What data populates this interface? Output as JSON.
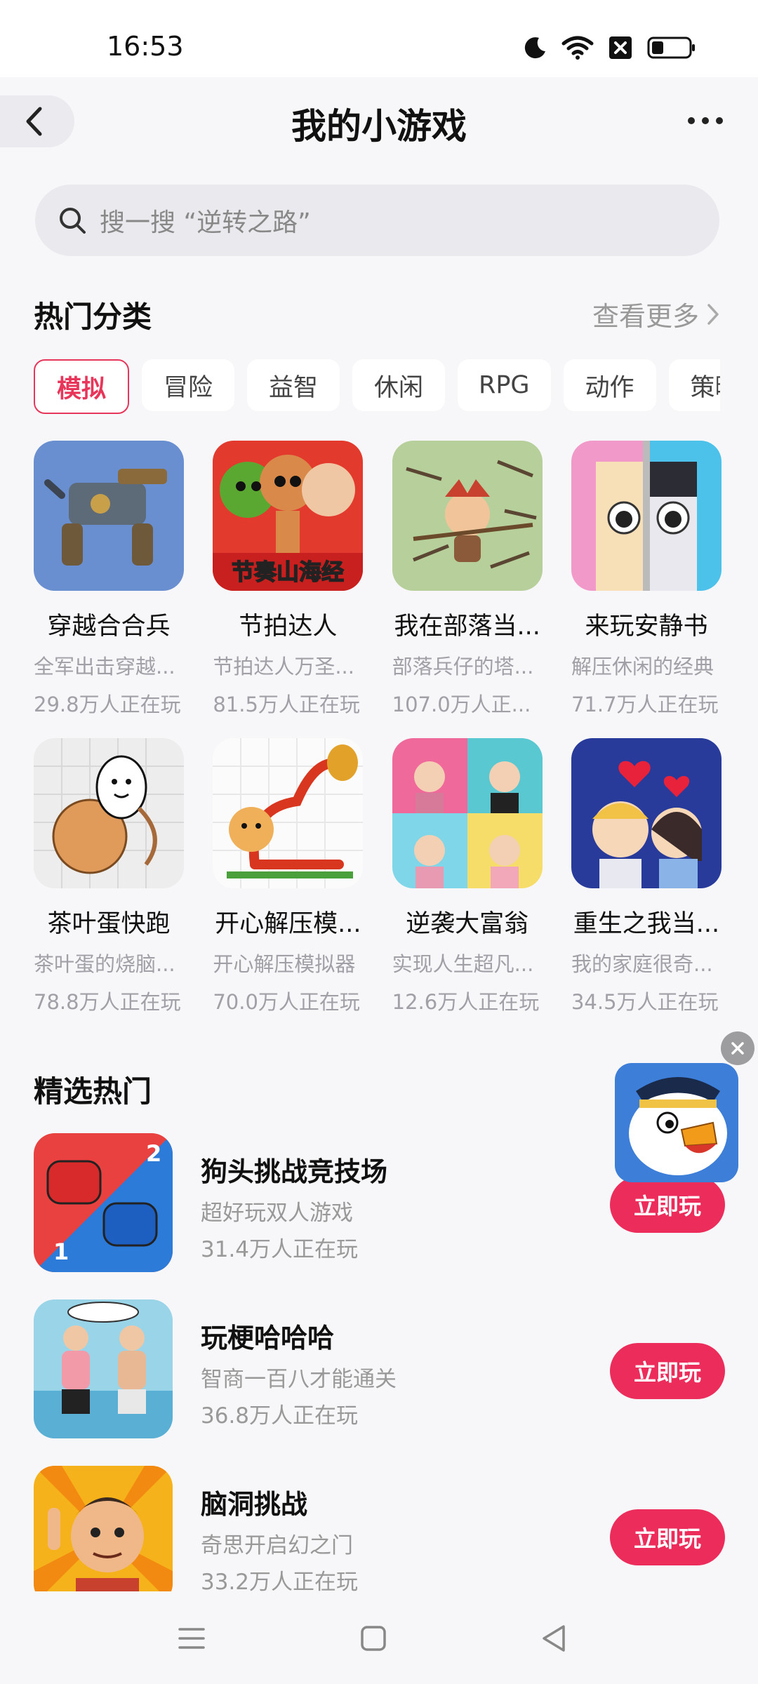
{
  "status": {
    "time": "16:53"
  },
  "header": {
    "title": "我的小游戏"
  },
  "search": {
    "placeholder": "搜一搜 “逆转之路”"
  },
  "hot_categories": {
    "title": "热门分类",
    "see_more": "查看更多",
    "chips": [
      "模拟",
      "冒险",
      "益智",
      "休闲",
      "RPG",
      "动作",
      "策略"
    ],
    "active_chip": "模拟",
    "games": [
      {
        "name": "穿越合合兵",
        "desc": "全军出击穿越...",
        "players": "29.8万人正在玩"
      },
      {
        "name": "节拍达人",
        "desc": "节拍达人万圣...",
        "players": "81.5万人正在玩",
        "icon_text": "节奏山海经"
      },
      {
        "name": "我在部落当...",
        "desc": "部落兵仔的塔...",
        "players": "107.0万人正..."
      },
      {
        "name": "来玩安静书",
        "desc": "解压休闲的经典",
        "players": "71.7万人正在玩"
      },
      {
        "name": "茶叶蛋快跑",
        "desc": "茶叶蛋的烧脑...",
        "players": "78.8万人正在玩"
      },
      {
        "name": "开心解压模...",
        "desc": "开心解压模拟器",
        "players": "70.0万人正在玩"
      },
      {
        "name": "逆袭大富翁",
        "desc": "实现人生超凡...",
        "players": "12.6万人正在玩"
      },
      {
        "name": "重生之我当...",
        "desc": "我的家庭很奇...",
        "players": "34.5万人正在玩"
      }
    ]
  },
  "featured": {
    "title": "精选热门",
    "play_label": "立即玩",
    "items": [
      {
        "name": "狗头挑战竞技场",
        "desc": "超好玩双人游戏",
        "players": "31.4万人正在玩"
      },
      {
        "name": "玩梗哈哈哈",
        "desc": "智商一百八才能通关",
        "players": "36.8万人正在玩"
      },
      {
        "name": "脑洞挑战",
        "desc": "奇思开启幻之门",
        "players": "33.2万人正在玩"
      }
    ]
  },
  "colors": {
    "accent": "#ec2c5a",
    "chip_active": "#e8365a",
    "background": "#f7f7f9"
  },
  "icons": [
    "moon-icon",
    "wifi-icon",
    "sim-off-icon",
    "battery-icon",
    "back-icon",
    "more-icon",
    "search-icon",
    "chevron-right-icon",
    "close-icon",
    "menu-icon",
    "home-icon",
    "back-nav-icon"
  ]
}
